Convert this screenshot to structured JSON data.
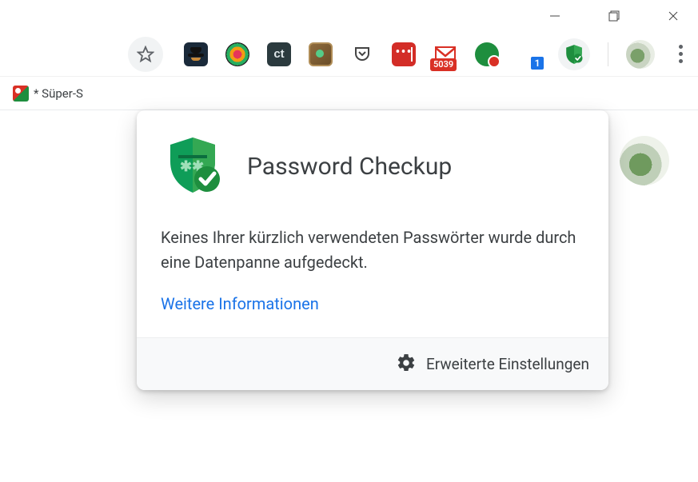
{
  "window": {
    "minimize": "minimize",
    "maximize": "maximize",
    "close": "close"
  },
  "toolbar": {
    "star_tooltip": "Bookmark",
    "extensions": {
      "ct_label": "ct",
      "lastpass_dots": "•••",
      "mail_badge": "5039",
      "blue_badge": "1"
    }
  },
  "bookmarks": {
    "item1_label": "* Süper-S"
  },
  "popup": {
    "title": "Password Checkup",
    "message": "Keines Ihrer kürzlich verwendeten Passwörter wurde durch eine Datenpanne aufgedeckt.",
    "more_info": "Weitere Informationen",
    "advanced_settings": "Erweiterte Einstellungen"
  },
  "colors": {
    "accent_green": "#1e8e3e",
    "link_blue": "#1a73e8",
    "text": "#3c4043"
  }
}
